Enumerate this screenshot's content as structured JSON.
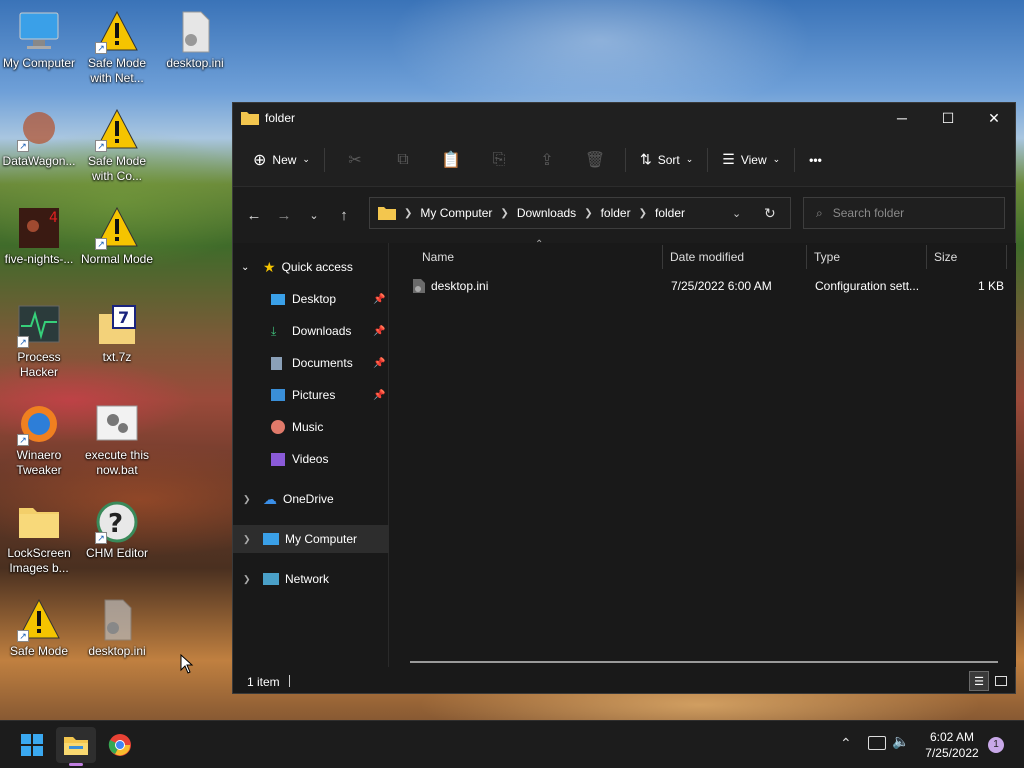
{
  "desktop": {
    "icons": [
      {
        "label": "My Computer",
        "icon": "monitor-icon"
      },
      {
        "label": "Safe Mode with Net...",
        "icon": "warning-icon"
      },
      {
        "label": "desktop.ini",
        "icon": "ini-file-icon"
      },
      {
        "label": "DataWagon...",
        "icon": "app-icon"
      },
      {
        "label": "Safe Mode with Co...",
        "icon": "warning-icon"
      },
      {
        "label": "five-nights-...",
        "icon": "game-icon"
      },
      {
        "label": "Normal Mode",
        "icon": "warning-icon"
      },
      {
        "label": "Process Hacker",
        "icon": "process-hacker-icon"
      },
      {
        "label": "txt.7z",
        "icon": "archive-icon"
      },
      {
        "label": "Winaero Tweaker",
        "icon": "winaero-icon"
      },
      {
        "label": "execute this now.bat",
        "icon": "batch-file-icon"
      },
      {
        "label": "LockScreen Images b...",
        "icon": "folder-icon"
      },
      {
        "label": "CHM Editor",
        "icon": "help-icon"
      },
      {
        "label": "Safe Mode",
        "icon": "warning-icon"
      },
      {
        "label": "desktop.ini",
        "icon": "ini-file-icon"
      }
    ]
  },
  "window": {
    "title": "folder",
    "controls": {
      "minimize": "─",
      "maximize": "☐",
      "close": "✕"
    }
  },
  "toolbar": {
    "new_label": "New",
    "sort_label": "Sort",
    "view_label": "View",
    "more_label": "•••"
  },
  "address": {
    "crumbs": [
      "My Computer",
      "Downloads",
      "folder",
      "folder"
    ],
    "search_placeholder": "Search folder"
  },
  "nav": {
    "quick_access": "Quick access",
    "pinned": [
      "Desktop",
      "Downloads",
      "Documents",
      "Pictures"
    ],
    "unpinned": [
      "Music",
      "Videos"
    ],
    "onedrive": "OneDrive",
    "my_computer": "My Computer",
    "network": "Network"
  },
  "columns": {
    "name": "Name",
    "date": "Date modified",
    "type": "Type",
    "size": "Size"
  },
  "files": [
    {
      "name": "desktop.ini",
      "date": "7/25/2022 6:00 AM",
      "type": "Configuration sett...",
      "size": "1 KB"
    }
  ],
  "status": {
    "count": "1 item"
  },
  "taskbar": {
    "time": "6:02 AM",
    "date": "7/25/2022",
    "notifications": "1"
  }
}
